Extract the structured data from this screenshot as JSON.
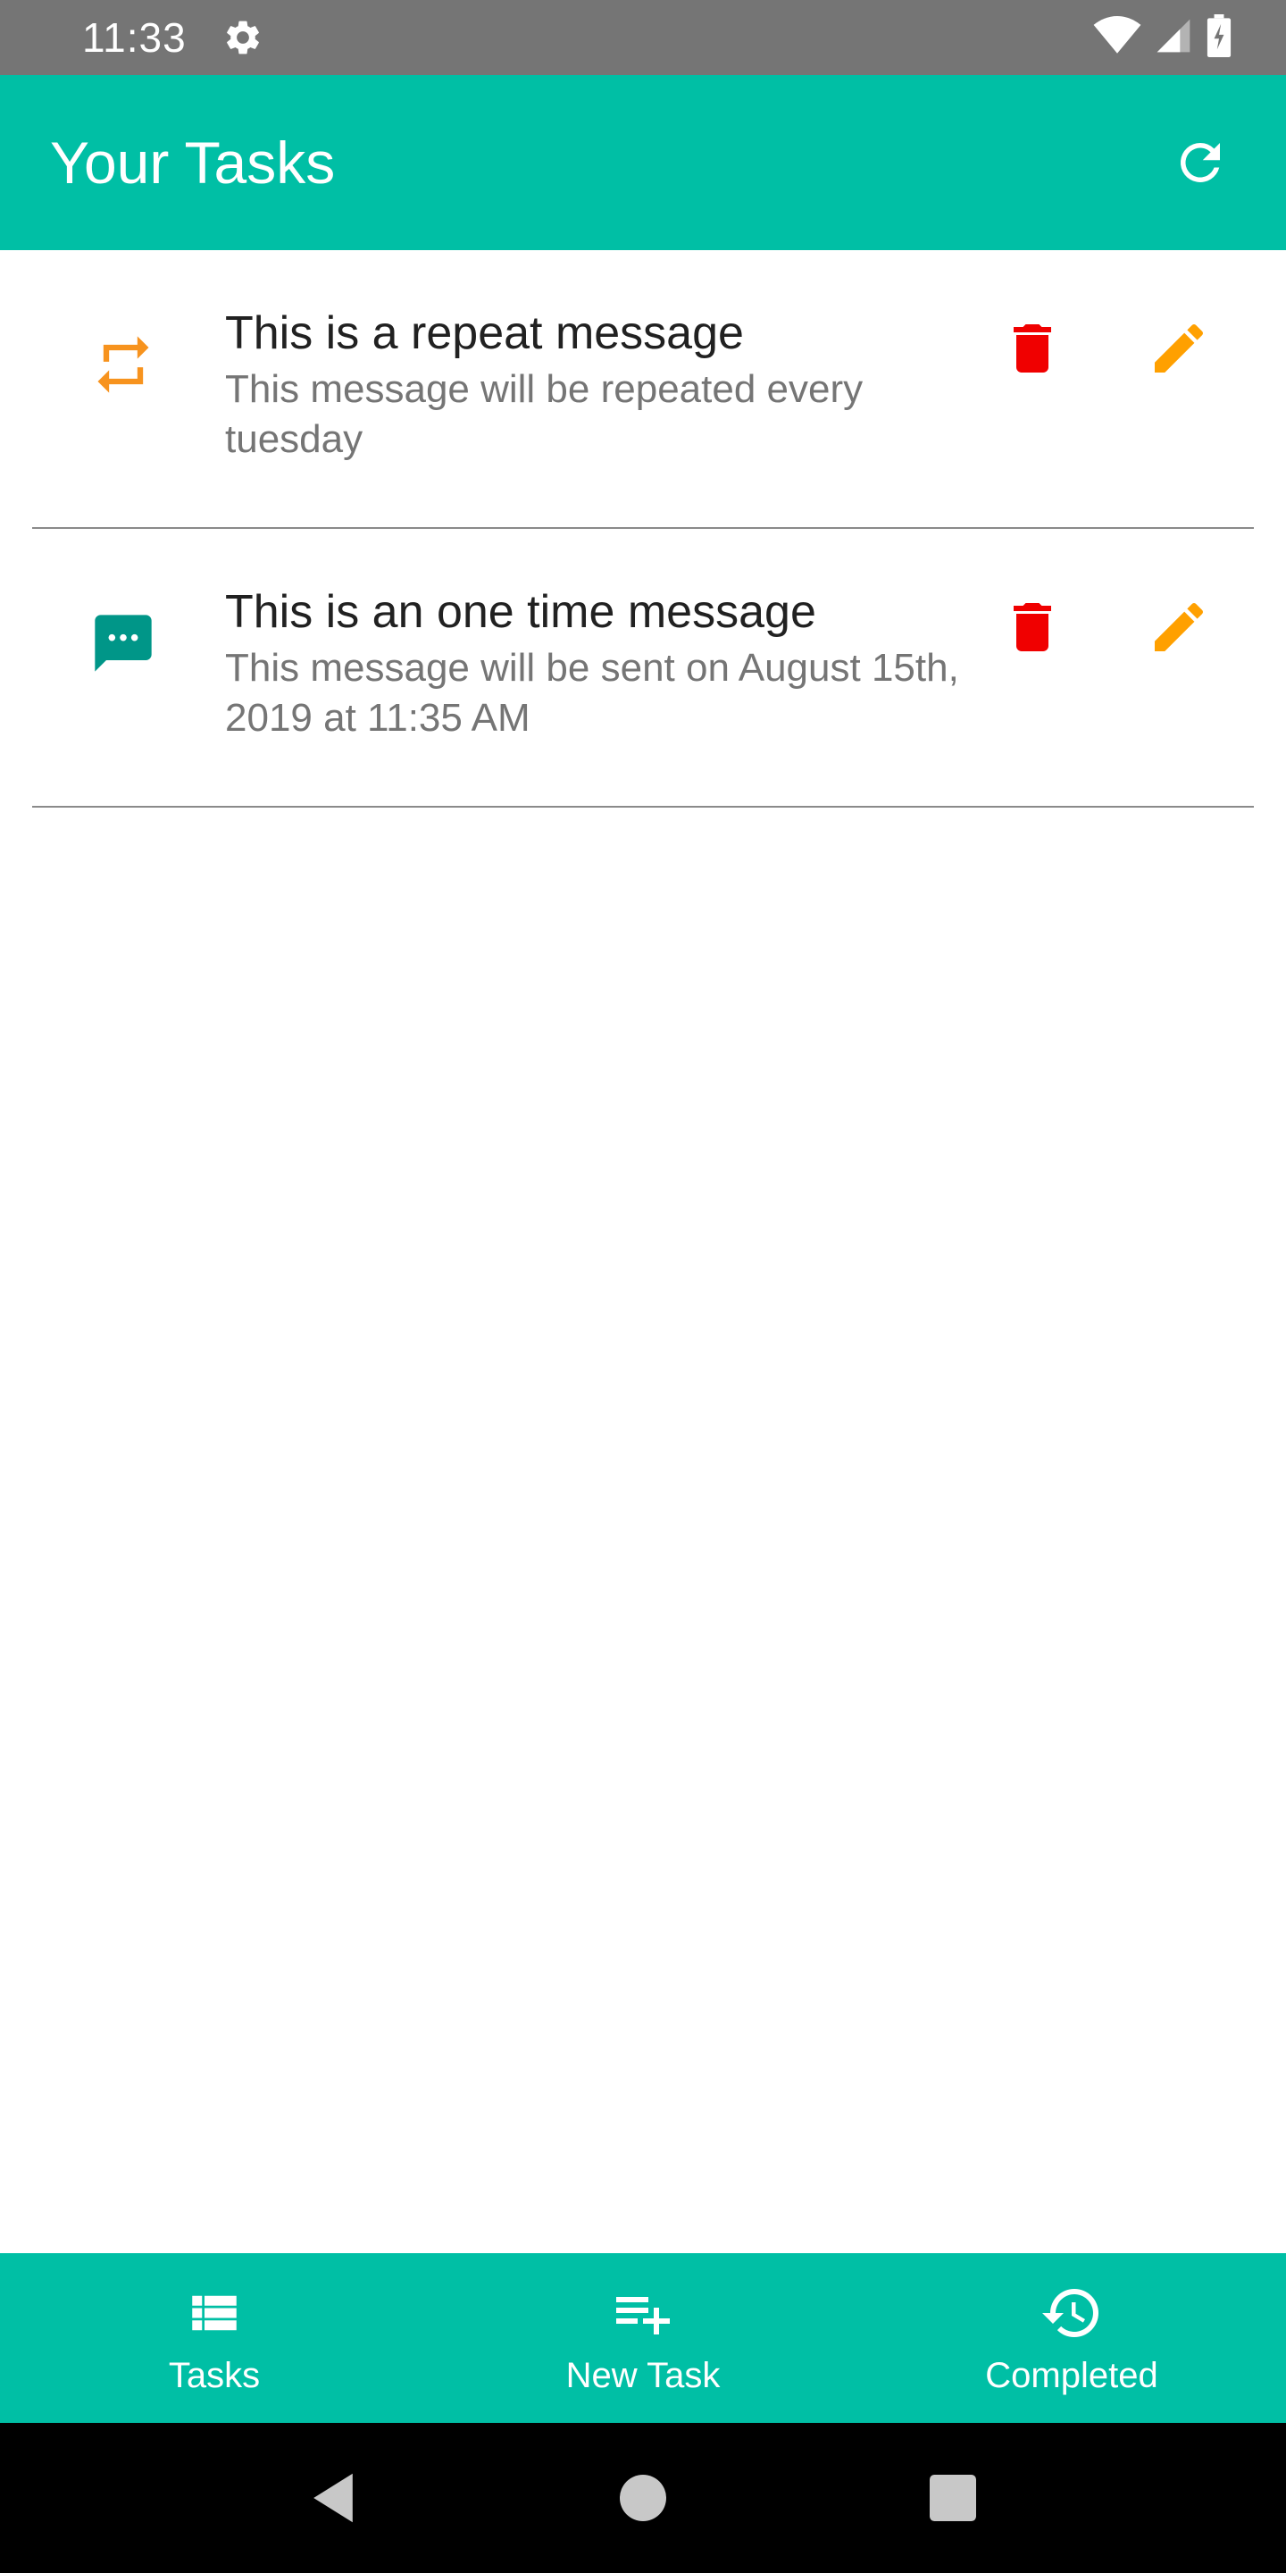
{
  "status_bar": {
    "time": "11:33",
    "icons": [
      "settings-icon",
      "wifi-icon",
      "signal-icon",
      "battery-charging-icon"
    ]
  },
  "app_bar": {
    "title": "Your Tasks",
    "refresh_icon": "refresh-icon"
  },
  "colors": {
    "primary": "#00BFA5",
    "repeat_icon": "#F7931E",
    "message_icon": "#009688",
    "delete": "#F00000",
    "edit": "#FFA000",
    "status_bar": "#757575"
  },
  "tasks": [
    {
      "type_icon": "repeat-icon",
      "title": "This is a repeat message",
      "subtitle": "This message will be repeated every tuesday"
    },
    {
      "type_icon": "message-icon",
      "title": "This is an one time message",
      "subtitle": "This message will be sent on August 15th, 2019 at 11:35 AM"
    }
  ],
  "bottom_nav": {
    "items": [
      {
        "label": "Tasks",
        "icon": "list-icon"
      },
      {
        "label": "New Task",
        "icon": "playlist-add-icon"
      },
      {
        "label": "Completed",
        "icon": "history-icon"
      }
    ]
  },
  "system_nav": {
    "icons": [
      "back-icon",
      "home-icon",
      "recents-icon"
    ]
  }
}
